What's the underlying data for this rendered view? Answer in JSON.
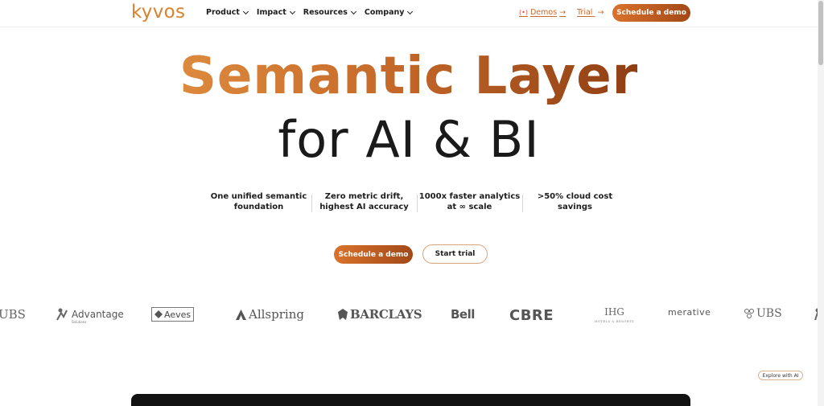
{
  "header": {
    "logo": "kyvos",
    "nav": [
      {
        "label": "Product"
      },
      {
        "label": "Impact"
      },
      {
        "label": "Resources"
      },
      {
        "label": "Company"
      }
    ],
    "demos_prefix": "(•)",
    "demos_label": "Demos",
    "trial_label": "Trial",
    "arrow": "→",
    "cta_label": "Schedule a demo"
  },
  "hero": {
    "title_line1": "Semantic Layer",
    "title_line2": "for AI & BI",
    "stats": [
      {
        "line1": "One unified semantic",
        "line2": "foundation"
      },
      {
        "line1": "Zero metric drift,",
        "line2": "highest AI accuracy"
      },
      {
        "line1": "1000x faster analytics",
        "line2": "at ∞ scale"
      },
      {
        "line1": ">50% cloud cost",
        "line2": "savings"
      }
    ],
    "primary_cta": "Schedule a demo",
    "secondary_cta": "Start trial"
  },
  "logos": {
    "ubs_left": "UBS",
    "advantage": "Advantage",
    "advantage_sub": "Solutions",
    "aeves": "Aeves",
    "allspring": "Allspring",
    "barclays": "BARCLAYS",
    "bell": "Bell",
    "cbre": "CBRE",
    "ihg": "IHG",
    "ihg_sub": "HOTELS & RESORTS",
    "merative": "merative",
    "ubs_right": "UBS"
  },
  "explore": {
    "label": "Explore with AI"
  },
  "colors": {
    "brand_orange": "#d9822e",
    "brand_dark": "#a24918",
    "dark_panel": "#121212"
  }
}
